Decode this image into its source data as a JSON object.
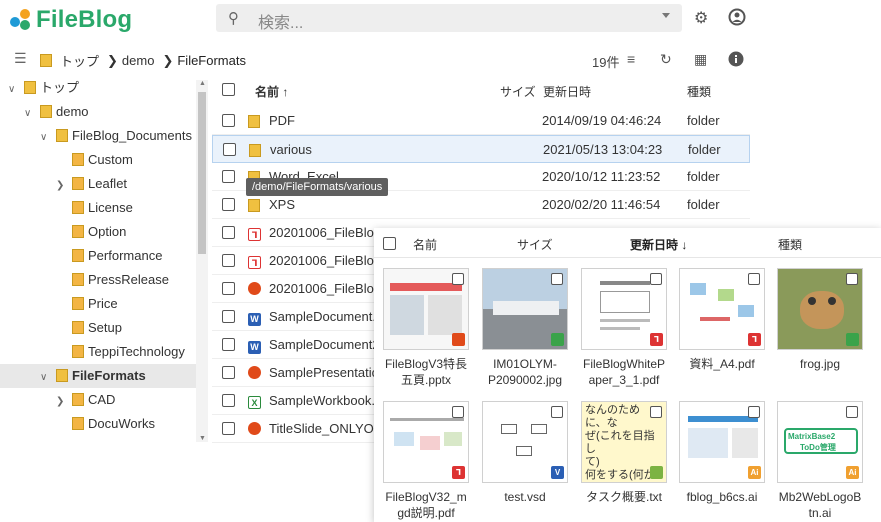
{
  "app": {
    "logo_text": "FileBlog"
  },
  "search": {
    "placeholder": "検索..."
  },
  "breadcrumb": {
    "root": "トップ",
    "items": [
      "demo",
      "FileFormats"
    ],
    "count": "19件"
  },
  "tree": [
    {
      "label": "トップ",
      "indent": 0,
      "chevron": "open"
    },
    {
      "label": "demo",
      "indent": 1,
      "chevron": "open"
    },
    {
      "label": "FileBlog_Documents",
      "indent": 2,
      "chevron": "open"
    },
    {
      "label": "Custom",
      "indent": 3,
      "chevron": "none"
    },
    {
      "label": "Leaflet",
      "indent": 3,
      "chevron": "closed"
    },
    {
      "label": "License",
      "indent": 3,
      "chevron": "none"
    },
    {
      "label": "Option",
      "indent": 3,
      "chevron": "none"
    },
    {
      "label": "Performance",
      "indent": 3,
      "chevron": "none"
    },
    {
      "label": "PressRelease",
      "indent": 3,
      "chevron": "none"
    },
    {
      "label": "Price",
      "indent": 3,
      "chevron": "none"
    },
    {
      "label": "Setup",
      "indent": 3,
      "chevron": "none"
    },
    {
      "label": "TeppiTechnology",
      "indent": 3,
      "chevron": "none"
    },
    {
      "label": "FileFormats",
      "indent": 2,
      "chevron": "open",
      "selected": true
    },
    {
      "label": "CAD",
      "indent": 3,
      "chevron": "closed"
    },
    {
      "label": "DocuWorks",
      "indent": 3,
      "chevron": "none"
    }
  ],
  "list": {
    "headers": {
      "name": "名前 ↑",
      "size": "サイズ",
      "date": "更新日時",
      "type": "種類"
    },
    "rows": [
      {
        "name": "PDF",
        "date": "2014/09/19 04:46:24",
        "type": "folder",
        "icon": "folder"
      },
      {
        "name": "various",
        "date": "2021/05/13 13:04:23",
        "type": "folder",
        "icon": "folder",
        "selected": true
      },
      {
        "name": "Word_Excel",
        "date": "2020/10/12 11:23:52",
        "type": "folder",
        "icon": "folder"
      },
      {
        "name": "XPS",
        "date": "2020/02/20 11:46:54",
        "type": "folder",
        "icon": "folder"
      },
      {
        "name": "20201006_FileBlo",
        "date": "",
        "type": "",
        "icon": "pdf"
      },
      {
        "name": "20201006_FileBlo",
        "date": "",
        "type": "",
        "icon": "pdf"
      },
      {
        "name": "20201006_FileBlo",
        "date": "",
        "type": "",
        "icon": "ppt"
      },
      {
        "name": "SampleDocument.",
        "date": "",
        "type": "",
        "icon": "doc"
      },
      {
        "name": "SampleDocument2",
        "date": "",
        "type": "",
        "icon": "doc"
      },
      {
        "name": "SamplePresentatic",
        "date": "",
        "type": "",
        "icon": "ppt"
      },
      {
        "name": "SampleWorkbook.",
        "date": "",
        "type": "",
        "icon": "xls"
      },
      {
        "name": "TitleSlide_ONLYOF",
        "date": "",
        "type": "",
        "icon": "ppt"
      }
    ]
  },
  "tooltip": "/demo/FileFormats/various",
  "grid": {
    "headers": {
      "name": "名前",
      "size": "サイズ",
      "date": "更新日時 ↓",
      "type": "種類"
    },
    "tiles": [
      {
        "name": "FileBlogV3特長五頁.pptx",
        "line1": "FileBlogV3特長",
        "line2": "五頁.pptx",
        "badge": "ppt"
      },
      {
        "name": "IM01OLYM-P2090002.jpg",
        "line1": "IM01OLYM-",
        "line2": "P2090002.jpg",
        "badge": "img"
      },
      {
        "name": "FileBlogWhitePaper_3_1.pdf",
        "line1": "FileBlogWhiteP",
        "line2": "aper_3_1.pdf",
        "badge": "pdf"
      },
      {
        "name": "資料_A4.pdf",
        "line1": "資料_A4.pdf",
        "line2": "",
        "badge": "pdf"
      },
      {
        "name": "frog.jpg",
        "line1": "frog.jpg",
        "line2": "",
        "badge": "img"
      },
      {
        "name": "FileBlogV32_mgd説明.pdf",
        "line1": "FileBlogV32_m",
        "line2": "gd説明.pdf",
        "badge": "pdf"
      },
      {
        "name": "test.vsd",
        "line1": "test.vsd",
        "line2": "",
        "badge": "vsd"
      },
      {
        "name": "タスク概要.txt",
        "line1": "タスク概要.txt",
        "line2": "",
        "badge": "txt"
      },
      {
        "name": "fblog_b6cs.ai",
        "line1": "fblog_b6cs.ai",
        "line2": "",
        "badge": "ai"
      },
      {
        "name": "Mb2WebLogoBtn.ai",
        "line1": "Mb2WebLogoB",
        "line2": "tn.ai",
        "badge": "ai"
      }
    ],
    "txt_preview": [
      "なんのために、な",
      "ぜ(これを目指し",
      "て)",
      "何をする(何かを",
      "する)"
    ],
    "logo_preview": [
      "MatrixBase2",
      "ToDo管理"
    ]
  },
  "colors": {
    "brand": "#2aa86a",
    "folder": "#f0c040",
    "selection": "#eaf2fb"
  }
}
